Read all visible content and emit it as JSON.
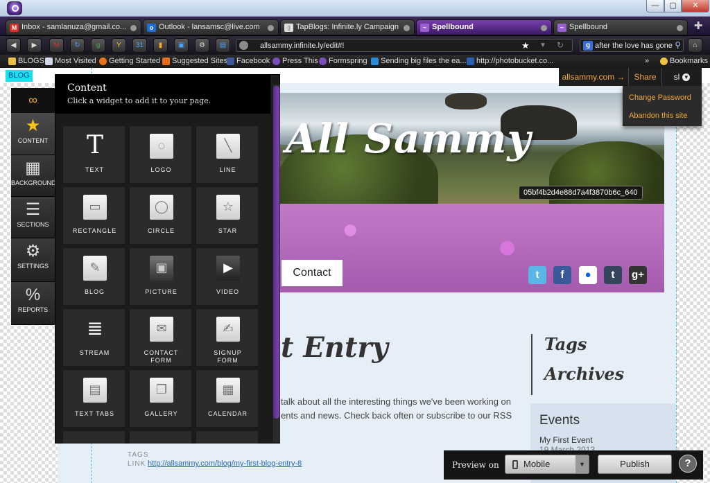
{
  "window": {
    "controls": {
      "minimize": "—",
      "maximize": "▢",
      "close": "✕"
    }
  },
  "tabs": [
    {
      "label": "Inbox - samlanuza@gmail.co...",
      "icon": "gmail-icon",
      "color": "#d93025",
      "active": false
    },
    {
      "label": "Outlook - lansamsc@live.com",
      "icon": "outlook-icon",
      "color": "#1d6fd6",
      "active": false
    },
    {
      "label": "TapBlogs: Infinite.ly Campaign",
      "icon": "page-icon",
      "color": "#dddddd",
      "active": false
    },
    {
      "label": "Spellbound",
      "icon": "spellbound-icon",
      "color": "#9b5fd0",
      "active": true
    },
    {
      "label": "Spellbound",
      "icon": "spellbound-icon",
      "color": "#9b5fd0",
      "active": false
    }
  ],
  "navbar": {
    "url": "allsammy.infinite.ly/edit#!",
    "search_value": "after the love has gone"
  },
  "bookmarks": [
    {
      "label": "BLOGS",
      "color": "#e8c046"
    },
    {
      "label": "Most Visited",
      "color": "#cfd8e8"
    },
    {
      "label": "Getting Started",
      "color": "#e8731a"
    },
    {
      "label": "Suggested Sites",
      "color": "#e86b1a"
    },
    {
      "label": "Facebook",
      "color": "#3b5998"
    },
    {
      "label": "Press This",
      "color": "#7a4fb8"
    },
    {
      "label": "Formspring",
      "color": "#7a4fb8"
    },
    {
      "label": "Sending big files the ea...",
      "color": "#2a8ad6"
    },
    {
      "label": "http://photobucket.co...",
      "color": "#2a5fb0"
    },
    {
      "label": "Bookmarks",
      "color": "#f0c040"
    }
  ],
  "bookmarks_overflow": "»",
  "page": {
    "blog_tag": "BLOG",
    "hero_title": "All Sammy",
    "image_id": "05bf4b2d4e88d7a4f3870b6c_640",
    "contact_nav": "Contact",
    "entry_title": "t Entry",
    "entry_body": "talk about all the interesting things we've been working on ents and news. Check back often or subscribe to our RSS",
    "sidebar_links": [
      "Tags",
      "Archives"
    ],
    "events": {
      "title": "Events",
      "item": "My First Event",
      "date": "19 March 2013"
    },
    "tags_label": "TAGS",
    "link_label": "LINK",
    "permalink": "http://allsammy.com/blog/my-first-blog-entry-8"
  },
  "editor_topbar": {
    "site_link": "allsammy.com →",
    "share": "Share",
    "user": "sl",
    "dropdown": [
      "Change Password",
      "Abandon this site"
    ]
  },
  "side_tabs": [
    {
      "label": "CONTENT",
      "icon": "star-icon",
      "glyph": "★"
    },
    {
      "label": "BACKGROUND",
      "icon": "background-icon",
      "glyph": "▦"
    },
    {
      "label": "SECTIONS",
      "icon": "sections-icon",
      "glyph": "☰"
    },
    {
      "label": "SETTINGS",
      "icon": "gear-icon",
      "glyph": "⚙"
    },
    {
      "label": "REPORTS",
      "icon": "percent-icon",
      "glyph": "%"
    }
  ],
  "widget_panel": {
    "title": "Content",
    "subtitle": "Click a widget to add it to your page.",
    "widgets": [
      {
        "label": "TEXT",
        "icon": "text-icon",
        "glyph": "T"
      },
      {
        "label": "LOGO",
        "icon": "logo-icon",
        "glyph": "◌"
      },
      {
        "label": "LINE",
        "icon": "line-icon",
        "glyph": "╲"
      },
      {
        "label": "RECTANGLE",
        "icon": "rectangle-icon",
        "glyph": "▭"
      },
      {
        "label": "CIRCLE",
        "icon": "circle-icon",
        "glyph": "◯"
      },
      {
        "label": "STAR",
        "icon": "star-outline-icon",
        "glyph": "☆"
      },
      {
        "label": "BLOG",
        "icon": "blog-icon",
        "glyph": "✎"
      },
      {
        "label": "PICTURE",
        "icon": "picture-icon",
        "glyph": "▣"
      },
      {
        "label": "VIDEO",
        "icon": "video-icon",
        "glyph": "▶"
      },
      {
        "label": "STREAM",
        "icon": "stream-icon",
        "glyph": "≣"
      },
      {
        "label": "CONTACT FORM",
        "icon": "envelope-icon",
        "glyph": "✉"
      },
      {
        "label": "SIGNUP FORM",
        "icon": "signup-form-icon",
        "glyph": "✍"
      },
      {
        "label": "TEXT TABS",
        "icon": "text-tabs-icon",
        "glyph": "▤"
      },
      {
        "label": "GALLERY",
        "icon": "gallery-icon",
        "glyph": "❐"
      },
      {
        "label": "CALENDAR",
        "icon": "calendar-icon",
        "glyph": "▦"
      }
    ]
  },
  "publish_bar": {
    "preview_label": "Preview on",
    "device": "Mobile",
    "publish": "Publish",
    "help": "?"
  }
}
